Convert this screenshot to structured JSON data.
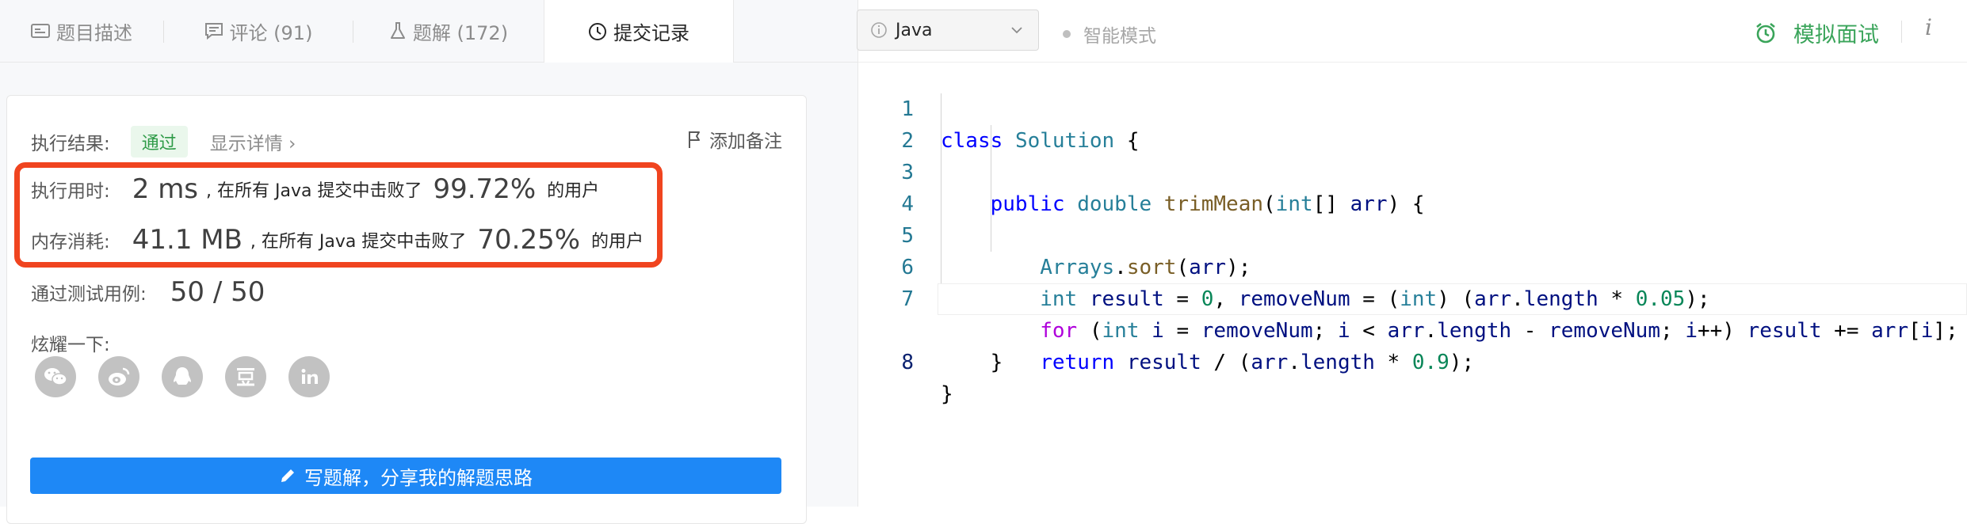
{
  "tabs": [
    {
      "label": "题目描述",
      "icon": "description-icon"
    },
    {
      "label": "评论 (91)",
      "icon": "comment-icon"
    },
    {
      "label": "题解 (172)",
      "icon": "flask-icon"
    },
    {
      "label": "提交记录",
      "icon": "clock-icon"
    }
  ],
  "result": {
    "label": "执行结果:",
    "status": "通过",
    "detail": "显示详情 ›",
    "add_note": "添加备注"
  },
  "runtime": {
    "label": "执行用时:",
    "value": "2 ms",
    "mid": ", 在所有 Java 提交中击败了",
    "percent": "99.72%",
    "suffix": "的用户"
  },
  "memory": {
    "label": "内存消耗:",
    "value": "41.1 MB",
    "mid": ", 在所有 Java 提交中击败了",
    "percent": "70.25%",
    "suffix": "的用户"
  },
  "tests": {
    "label": "通过测试用例:",
    "value": "50 / 50"
  },
  "share": {
    "label": "炫耀一下:",
    "icons": [
      "wechat-icon",
      "weibo-icon",
      "qq-icon",
      "douban-icon",
      "linkedin-icon"
    ]
  },
  "write_button": "写题解，分享我的解题思路",
  "editor": {
    "language": "Java",
    "smart_mode": "智能模式",
    "mock_interview": "模拟面试",
    "info": "i"
  },
  "code": {
    "line_numbers": [
      "1",
      "2",
      "3",
      "4",
      "5",
      "6",
      "7",
      "8"
    ],
    "lines": [
      "class Solution {",
      "    public double trimMean(int[] arr) {",
      "        Arrays.sort(arr);",
      "        int result = 0, removeNum = (int) (arr.length * 0.05);",
      "        for (int i = removeNum; i < arr.length - removeNum; i++) result += arr[i];",
      "        return result / (arr.length * 0.9);",
      "    }",
      "}"
    ]
  },
  "colors": {
    "accent": "#1e88f6",
    "success": "#2f9b48",
    "highlight_border": "#f0441f"
  }
}
